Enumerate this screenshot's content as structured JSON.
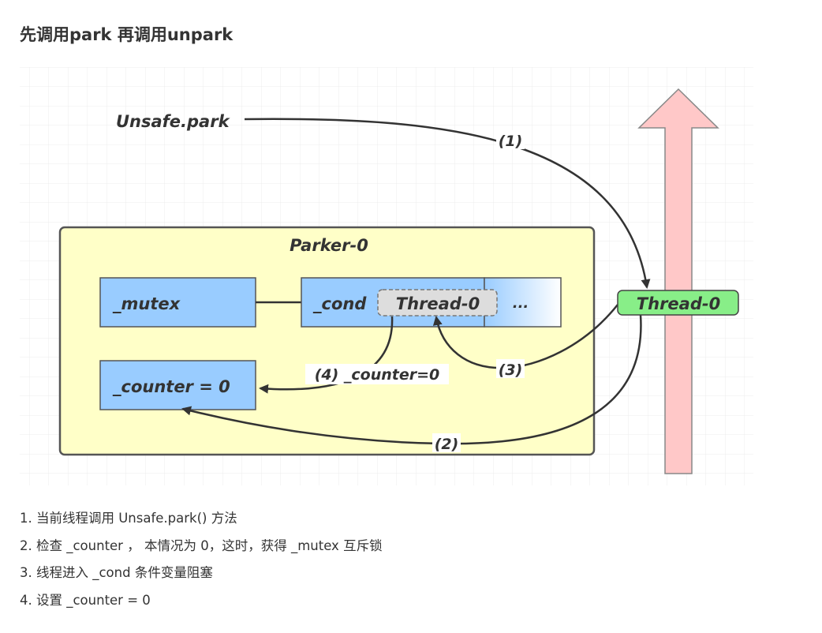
{
  "heading": "先调用park 再调用unpark",
  "diagram": {
    "caller_label": "Unsafe.park",
    "parker_label": "Parker-0",
    "mutex_label": "_mutex",
    "cond_label": "_cond",
    "cond_waiting_thread": "Thread-0",
    "cond_more": "...",
    "counter_label": "_counter = 0",
    "thread_label": "Thread-0",
    "arrows": [
      {
        "label": "(1)"
      },
      {
        "label": "(2)"
      },
      {
        "label": "(3)"
      },
      {
        "label": "(4) _counter=0"
      }
    ],
    "colors": {
      "parker_fill": "#ffffc8",
      "field_fill": "#99ccff",
      "thread_fill": "#88ee88",
      "waiting_fill": "#dddddd",
      "timeline_arrow_fill": "#ffc8c8"
    }
  },
  "steps": [
    "1. 当前线程调用 Unsafe.park() 方法",
    "2. 检查 _counter ， 本情况为 0，这时，获得 _mutex 互斥锁",
    "3. 线程进入 _cond 条件变量阻塞",
    "4. 设置 _counter = 0"
  ]
}
